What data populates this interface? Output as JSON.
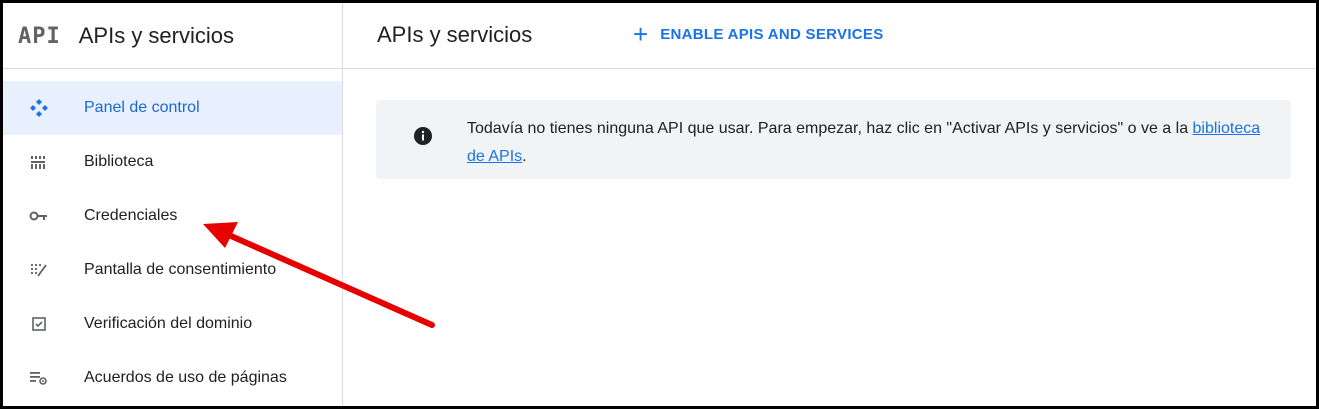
{
  "header": {
    "logo_text": "API",
    "app_title": "APIs y servicios",
    "page_title": "APIs y servicios",
    "enable_button": {
      "icon": "plus-icon",
      "label": "ENABLE APIS AND SERVICES"
    }
  },
  "sidebar": {
    "items": [
      {
        "label": "Panel de control",
        "icon": "dashboard-icon",
        "active": true
      },
      {
        "label": "Biblioteca",
        "icon": "library-icon",
        "active": false
      },
      {
        "label": "Credenciales",
        "icon": "key-icon",
        "active": false
      },
      {
        "label": "Pantalla de consentimiento",
        "icon": "consent-screen-icon",
        "active": false
      },
      {
        "label": "Verificación del dominio",
        "icon": "checkbox-icon",
        "active": false
      },
      {
        "label": "Acuerdos de uso de páginas",
        "icon": "settings-list-icon",
        "active": false
      }
    ]
  },
  "banner": {
    "icon": "info-icon",
    "message_before": "Todavía no tienes ninguna API que usar. Para empezar, haz clic en \"Activar APIs y servicios\" o ve a la ",
    "link_text": "biblioteca de APIs",
    "message_after": "."
  },
  "annotation": {
    "color": "#e60000",
    "points_to": "Credenciales"
  },
  "colors": {
    "accent": "#1a73e8",
    "active_bg": "#e8f0fe",
    "banner_bg": "#f1f3f4",
    "divider": "#dadce0"
  }
}
